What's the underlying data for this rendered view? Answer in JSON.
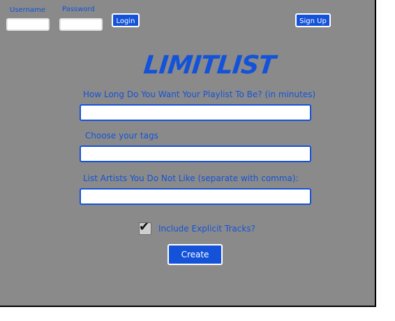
{
  "header": {
    "username_label": "Username",
    "password_label": "Password",
    "login_button": "Login",
    "signup_button": "Sign Up"
  },
  "brand": {
    "logo_text": "LIMITLIST"
  },
  "form": {
    "length_label": "How Long Do You Want Your Playlist To Be? (in minutes)",
    "tags_label": "Choose your tags",
    "artists_label": "List Artists You Do Not Like (separate with comma):",
    "explicit_label": "Include Explicit Tracks?",
    "explicit_checked": true,
    "create_button": "Create"
  },
  "colors": {
    "background": "#8a8a8a",
    "accent": "#1453d9",
    "field_background": "#ffffff"
  }
}
